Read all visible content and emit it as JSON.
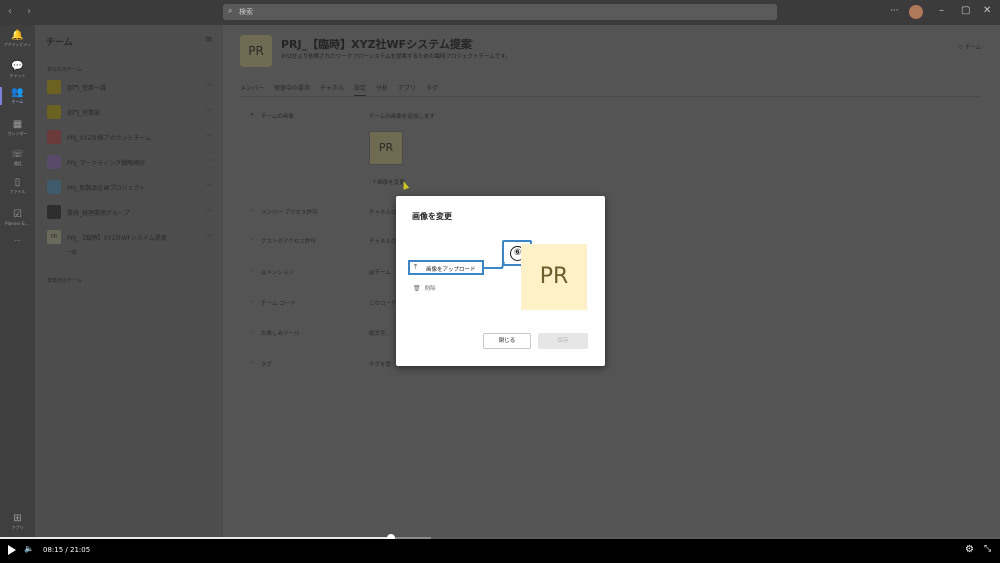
{
  "titlebar": {
    "search_placeholder": "検索"
  },
  "rail": [
    {
      "icon": "bell-icon",
      "glyph": "🔔",
      "label": "アクティビティ"
    },
    {
      "icon": "chat-icon",
      "glyph": "💬",
      "label": "チャット"
    },
    {
      "icon": "teams-icon",
      "glyph": "👥",
      "label": "チーム"
    },
    {
      "icon": "calendar-icon",
      "glyph": "▦",
      "label": "カレンダー"
    },
    {
      "icon": "phone-icon",
      "glyph": "☏",
      "label": "通話"
    },
    {
      "icon": "file-icon",
      "glyph": "▯",
      "label": "ファイル"
    },
    {
      "icon": "planner-icon",
      "glyph": "☑",
      "label": "Planner & ..."
    },
    {
      "icon": "apps-icon",
      "glyph": "⊞",
      "label": "アプリ"
    }
  ],
  "panel": {
    "title": "チーム",
    "your_teams_label": "あなたのチーム",
    "hidden_teams_label": "非表示のチーム",
    "teams": [
      {
        "name": "部門_営業一課",
        "color": "#6b6221"
      },
      {
        "name": "部門_営業部",
        "color": "#6b6221"
      },
      {
        "name": "PRJ_XYZ社様アカウントチーム",
        "color": "#6b3a3a"
      },
      {
        "name": "PRJ_マーケティング戦略検討",
        "color": "#5a4a6a"
      },
      {
        "name": "PRJ_新製品企画プロジェクト",
        "color": "#3f5a6a"
      },
      {
        "name": "業務_経理業務グループ",
        "color": "#2e2e2e"
      },
      {
        "name": "PRJ_【臨時】XYZ社WFシステム提案",
        "tile_text": "PR",
        "color": "#6a6a5a"
      }
    ],
    "sub_channel": "一般"
  },
  "header": {
    "avatar_text": "PR",
    "title": "PRJ_【臨時】XYZ社WFシステム提案",
    "description": "XYZ社より依頼されたワークフローシステムを提案するための臨時プロジェクトチームです。",
    "team_button": "チーム"
  },
  "tabs": [
    "メンバー",
    "保留中の要求",
    "チャネル",
    "設定",
    "分析",
    "アプリ",
    "タグ"
  ],
  "active_tab": "設定",
  "settings": [
    {
      "label": "チームの画像",
      "value": "チームの画像を追加します"
    },
    {
      "label": "メンバー アクセス許可",
      "value": "チャネルの"
    },
    {
      "label": "ゲストのアクセス許可",
      "value": "チャネルの"
    },
    {
      "label": "@メンション",
      "value": "@チーム"
    },
    {
      "label": "チーム コード",
      "value": "このコード"
    },
    {
      "label": "お楽しみツール",
      "value": "絵文字、"
    },
    {
      "label": "タグ",
      "value": "タグを管"
    }
  ],
  "picture": {
    "preview_text": "PR",
    "change_label": "画像を変更"
  },
  "dialog": {
    "title": "画像を変更",
    "upload_label": "画像をアップロード",
    "delete_label": "削除",
    "preview_text": "PR",
    "callout": "⑥",
    "close_button": "閉じる",
    "save_button": "保存"
  },
  "video": {
    "current": "08:15",
    "separator": "/",
    "total": "21:05",
    "played_fraction": 0.391,
    "buffered_fraction": 0.431
  }
}
